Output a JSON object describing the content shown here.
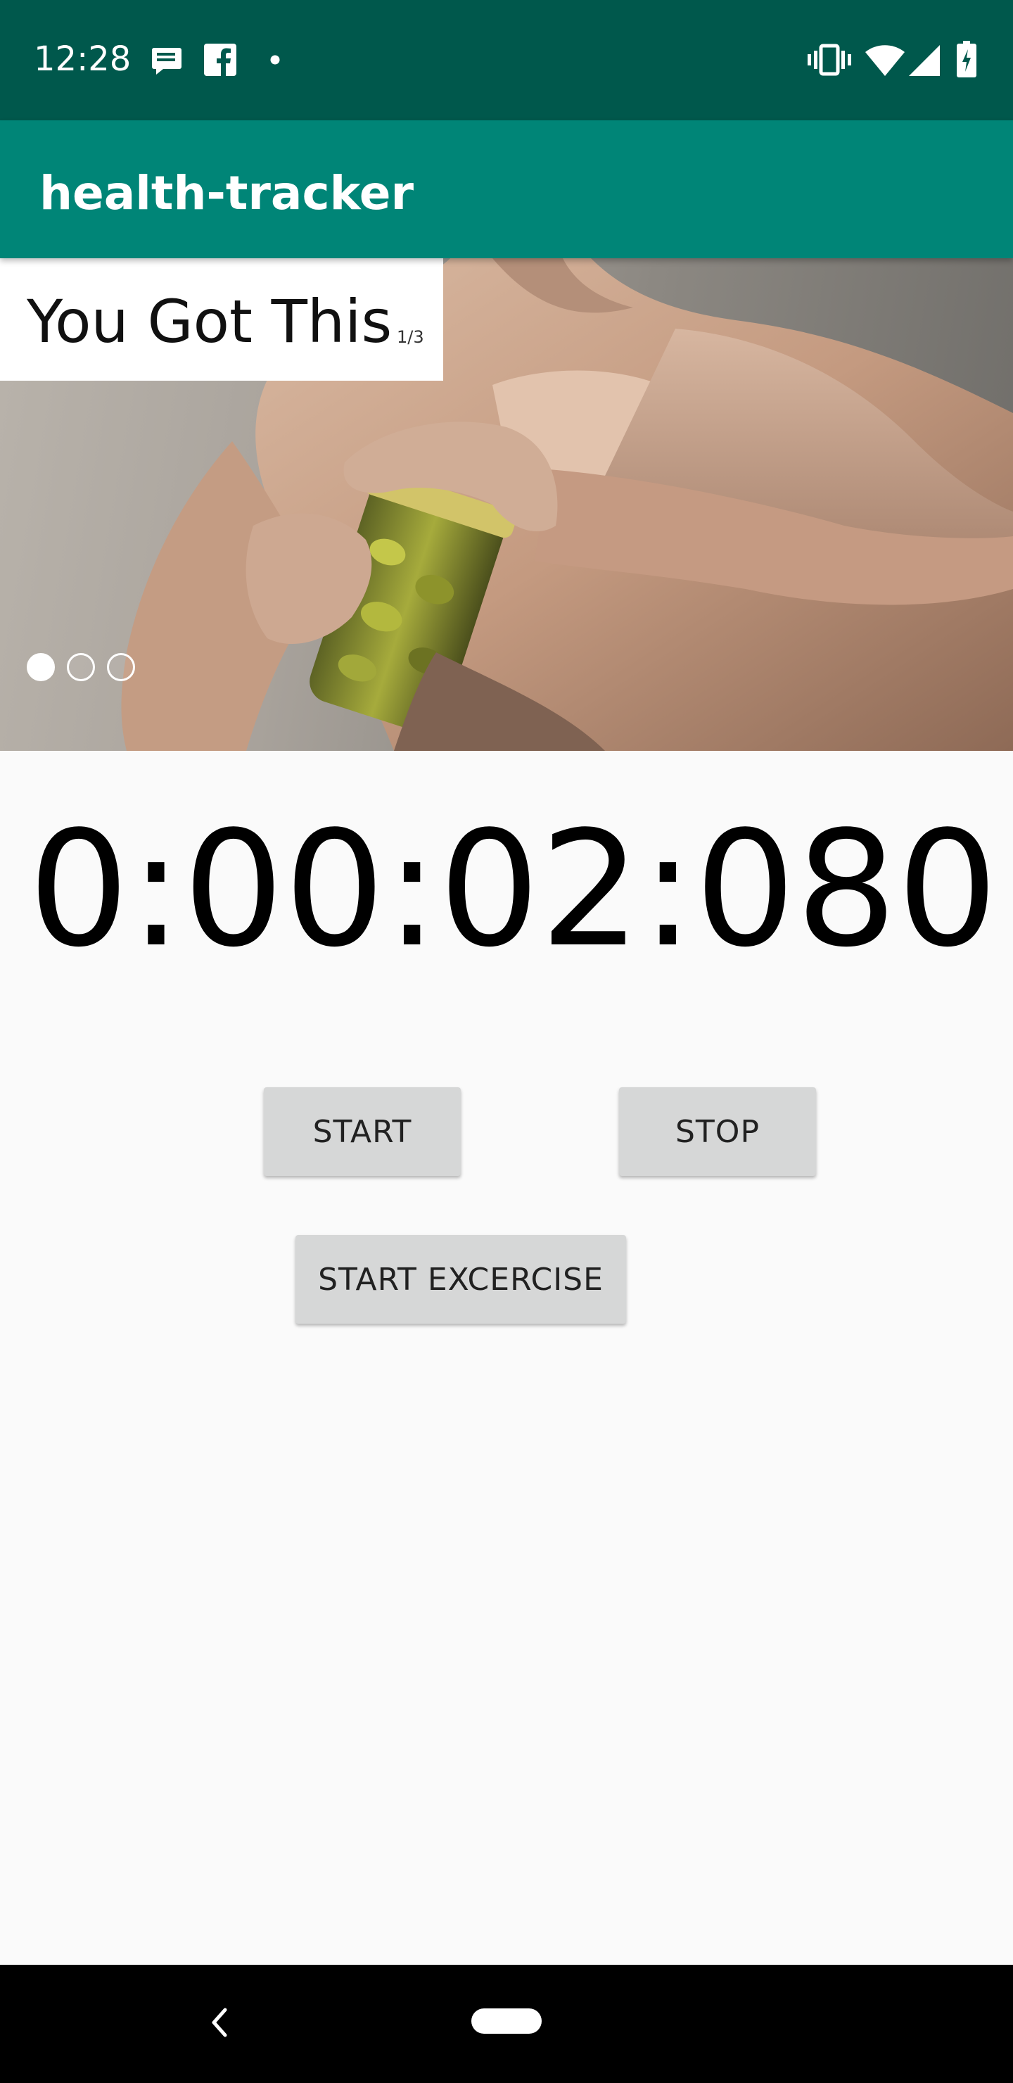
{
  "status_bar": {
    "time": "12:28",
    "left_icons": [
      "message-icon",
      "facebook-icon",
      "notification-dot-icon"
    ],
    "right_icons": [
      "vibrate-icon",
      "wifi-icon",
      "cell-signal-icon",
      "battery-charging-icon"
    ],
    "background": "#00584c"
  },
  "app_bar": {
    "title": "health-tracker",
    "background": "#008577"
  },
  "carousel": {
    "caption": "You Got This",
    "counter": "1/3",
    "image_icon": "muscular-man-opening-pickle-jar-photo",
    "active_index": 0,
    "total_slides": 3
  },
  "timer": {
    "value": "0:00:02:080"
  },
  "buttons": {
    "start_label": "START",
    "stop_label": "STOP",
    "start_exercise_label": "START EXCERCISE"
  },
  "nav_bar": {
    "back_icon": "back-chevron-icon",
    "home_icon": "home-pill-icon"
  }
}
